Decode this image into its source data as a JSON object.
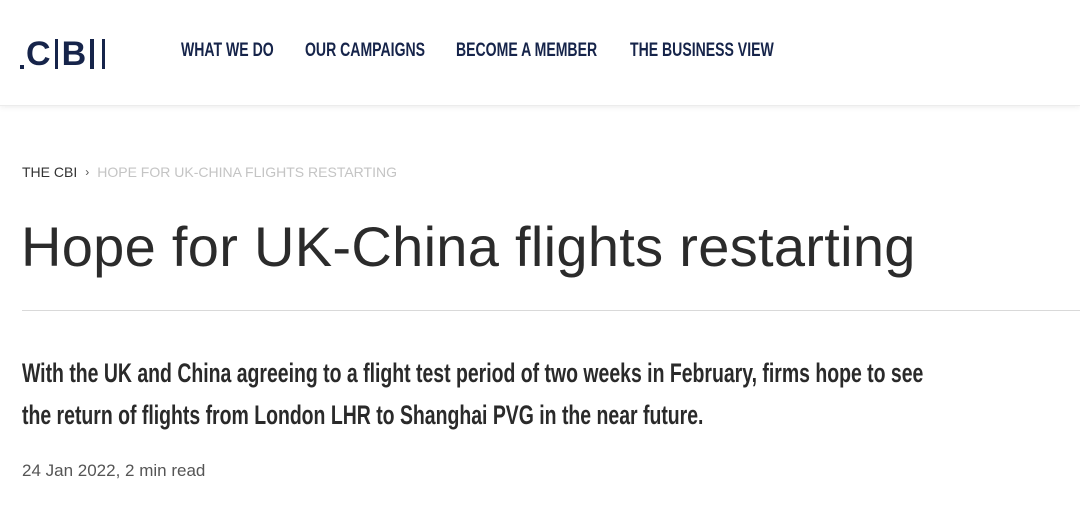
{
  "header": {
    "logo": {
      "letters": [
        "C",
        "B"
      ],
      "text": "CBI"
    },
    "nav": [
      {
        "label": "WHAT WE DO"
      },
      {
        "label": "OUR CAMPAIGNS"
      },
      {
        "label": "BECOME A MEMBER"
      },
      {
        "label": "THE BUSINESS VIEW"
      }
    ],
    "colors": {
      "brand": "#16244a"
    }
  },
  "breadcrumb": {
    "home": "THE CBI",
    "separator": "›",
    "current": "HOPE FOR UK-CHINA FLIGHTS RESTARTING"
  },
  "article": {
    "title": "Hope for UK-China flights restarting",
    "standfirst_lines": [
      "With the UK and China agreeing to a flight test period of two weeks in February, firms hope to see",
      "the return of flights from London LHR to Shanghai PVG in the near future."
    ],
    "meta": "24 Jan 2022, 2 min read"
  }
}
